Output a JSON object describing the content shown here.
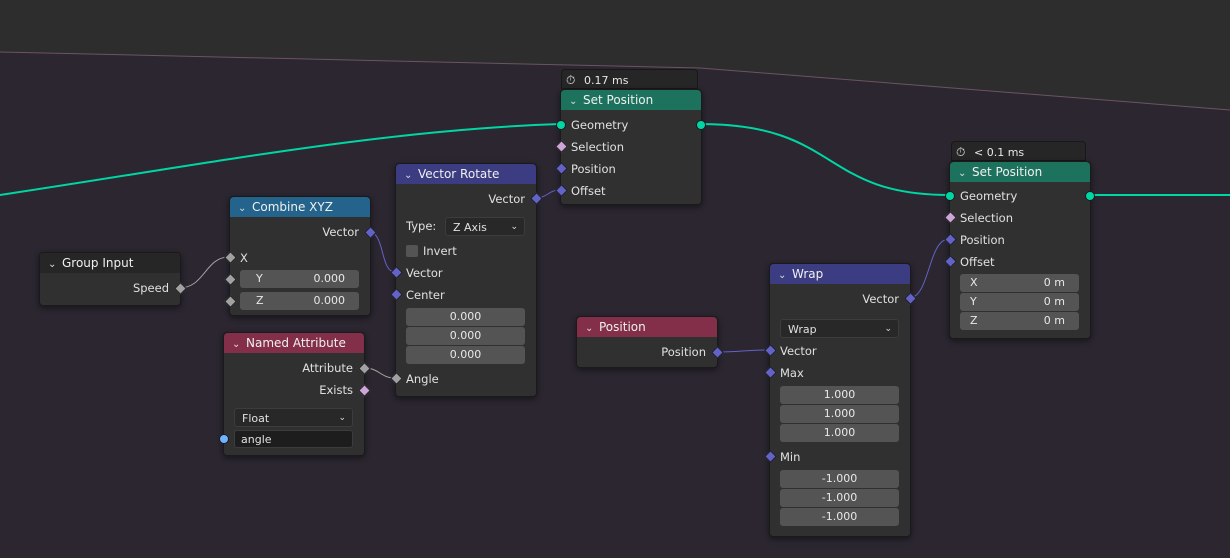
{
  "nodes": {
    "set_position_1": {
      "timing": "0.17 ms",
      "title": "Set Position",
      "outputs": [
        "Geometry"
      ],
      "inputs": [
        "Selection",
        "Position",
        "Offset"
      ]
    },
    "set_position_2": {
      "timing": "< 0.1 ms",
      "title": "Set Position",
      "outputs": [
        "Geometry"
      ],
      "inputs": [
        "Selection",
        "Position",
        "Offset"
      ],
      "offset": [
        {
          "label": "X",
          "value": "0 m"
        },
        {
          "label": "Y",
          "value": "0 m"
        },
        {
          "label": "Z",
          "value": "0 m"
        }
      ]
    },
    "group_input": {
      "title": "Group Input",
      "outputs": [
        "Speed"
      ]
    },
    "combine_xyz": {
      "title": "Combine XYZ",
      "outputs": [
        "Vector"
      ],
      "inputs": [
        "X",
        "Y",
        "Z"
      ],
      "y_value": "0.000",
      "z_value": "0.000"
    },
    "vector_rotate": {
      "title": "Vector Rotate",
      "outputs": [
        "Vector"
      ],
      "type_label": "Type:",
      "type_value": "Z Axis",
      "invert_label": "Invert",
      "inputs": [
        "Vector",
        "Center",
        "Angle"
      ],
      "center": [
        "0.000",
        "0.000",
        "0.000"
      ]
    },
    "named_attribute": {
      "title": "Named Attribute",
      "outputs": [
        "Attribute",
        "Exists"
      ],
      "data_type": "Float",
      "name_value": "angle"
    },
    "position": {
      "title": "Position",
      "outputs": [
        "Position"
      ]
    },
    "wrap": {
      "title": "Wrap",
      "outputs": [
        "Vector"
      ],
      "mode": "Wrap",
      "inputs": [
        "Vector",
        "Max",
        "Min"
      ],
      "max": [
        "1.000",
        "1.000",
        "1.000"
      ],
      "min": [
        "-1.000",
        "-1.000",
        "-1.000"
      ]
    }
  },
  "colors": {
    "geometry": "#00d6a3",
    "vector": "#6363c7",
    "boolean": "#cca6d6",
    "float": "#a1a1a1",
    "string": "#70b2ff",
    "geometry_header": "#1d725e",
    "converter_header": "#24648c",
    "vector_header": "#3c3c83",
    "input_header": "#832f49"
  },
  "icons": {
    "timing": "stopwatch-icon",
    "collapse": "chevron-down-icon"
  }
}
